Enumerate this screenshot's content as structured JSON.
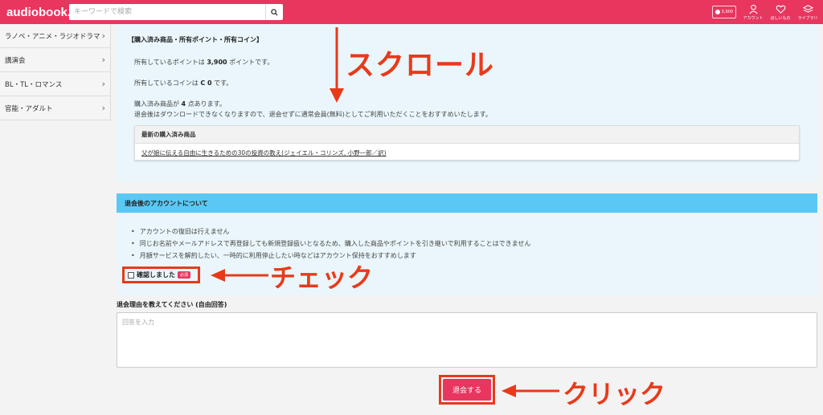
{
  "header": {
    "logo": "audiobook.jp",
    "search_placeholder": "キーワードで検索",
    "points_badge": "3,900",
    "icons": [
      {
        "name": "account-icon",
        "label": "アカウント"
      },
      {
        "name": "heart-icon",
        "label": "ほしいもの"
      },
      {
        "name": "library-icon",
        "label": "ライブラリ"
      }
    ]
  },
  "sidebar": {
    "items": [
      {
        "label": "ラノベ・アニメ・ラジオドラマ"
      },
      {
        "label": "講演会"
      },
      {
        "label": "BL・TL・ロマンス"
      },
      {
        "label": "官能・アダルト"
      }
    ]
  },
  "purchased": {
    "title": "【購入済み商品・所有ポイント・所有コイン】",
    "points_pre": "所有しているポイントは ",
    "points_value": "3,900",
    "points_post": " ポイントです。",
    "coins_pre": "所有しているコインは ",
    "coins_value": "C 0",
    "coins_post": " です。",
    "items_pre": "購入済み商品が ",
    "items_value": "4",
    "items_post": " 点あります。",
    "notice": "退会後はダウンロードできなくなりますので、退会せずに通常会員(無料)としてご利用いただくことをおすすめいたします。",
    "recent_heading": "最新の購入済み商品",
    "recent_item": "父が娘に伝える自由に生きるための30の投資の教え(ジェイエル・コリンズ, 小野一郎／訳)"
  },
  "account_after": {
    "heading": "退会後のアカウントについて",
    "bullets": [
      "アカウントの復旧は行えません",
      "同じお名前やメールアドレスで再登録しても新規登録扱いとなるため、購入した商品やポイントを引き継いで利用することはできません",
      "月額サービスを解約したい、一時的に利用停止したい時などはアカウント保持をおすすめします"
    ],
    "confirm_label": "確認しました",
    "required_badge": "必須"
  },
  "reason": {
    "label": "退会理由を教えてください (自由回答)",
    "placeholder": "回答を入力"
  },
  "submit": {
    "label": "退会する"
  },
  "annotations": {
    "scroll": "スクロール",
    "check": "チェック",
    "click": "クリック"
  },
  "colors": {
    "brand": "#e8365f",
    "info_bg": "#eaf6fb",
    "section_header": "#5bc8f4",
    "annotation": "#e83a1a"
  }
}
